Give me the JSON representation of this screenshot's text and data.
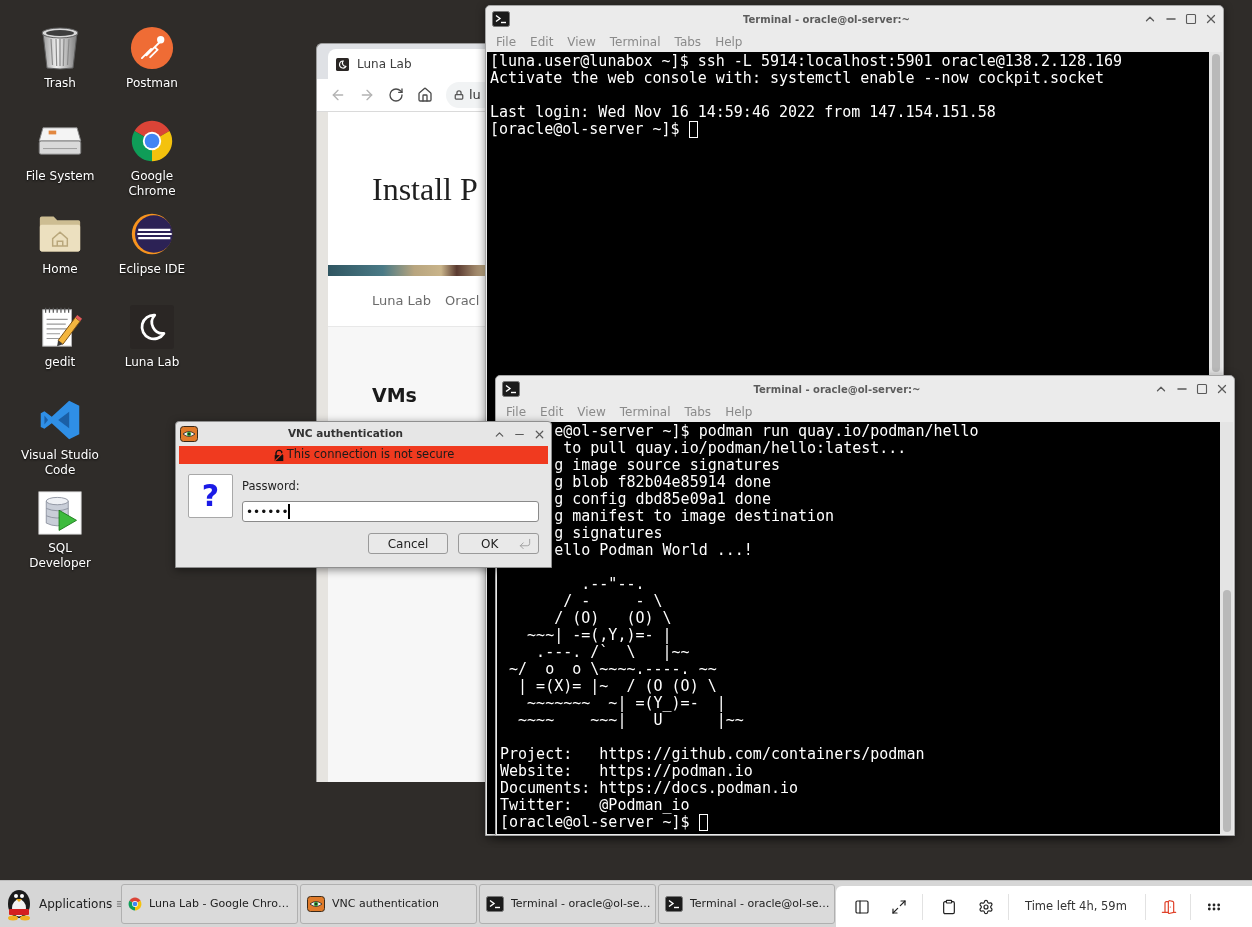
{
  "desktop_icons": [
    {
      "label": "Trash",
      "kind": "trash"
    },
    {
      "label": "File System",
      "kind": "drive"
    },
    {
      "label": "Home",
      "kind": "home"
    },
    {
      "label": "gedit",
      "kind": "gedit"
    },
    {
      "label": "Visual Studio Code",
      "kind": "vscode"
    },
    {
      "label": "SQL Developer",
      "kind": "sqldev"
    },
    {
      "label": "Postman",
      "kind": "postman"
    },
    {
      "label": "Google Chrome",
      "kind": "chrome"
    },
    {
      "label": "Eclipse IDE",
      "kind": "eclipse"
    },
    {
      "label": "Luna Lab",
      "kind": "luna"
    }
  ],
  "browser": {
    "tab": "Luna Lab",
    "nav_buttons": [
      {
        "kind": "back",
        "disabled": true
      },
      {
        "kind": "forward",
        "disabled": true
      },
      {
        "kind": "reload",
        "disabled": false
      },
      {
        "kind": "home",
        "disabled": false
      }
    ],
    "url": "lu",
    "page": {
      "title": "Install P",
      "nav": [
        "Luna Lab",
        "Oracl"
      ],
      "section": "VMs"
    }
  },
  "terminals": [
    {
      "title": "Terminal - oracle@ol-server:~",
      "menu": [
        "File",
        "Edit",
        "View",
        "Terminal",
        "Tabs",
        "Help"
      ],
      "lines": [
        {
          "kind": "output",
          "text": "[luna.user@lunabox ~]$ ssh -L 5914:localhost:5901 oracle@138.2.128.169"
        },
        {
          "kind": "output",
          "text": "Activate the web console with: systemctl enable --now cockpit.socket"
        },
        {
          "kind": "blank"
        },
        {
          "kind": "output",
          "text": "Last login: Wed Nov 16 14:59:46 2022 from 147.154.151.58"
        },
        {
          "kind": "prompt",
          "text": "[oracle@ol-server ~]$"
        }
      ]
    },
    {
      "title": "Terminal - oracle@ol-server:~",
      "menu": [
        "File",
        "Edit",
        "View",
        "Terminal",
        "Tabs",
        "Help"
      ],
      "lines": [
        {
          "kind": "cut",
          "text": "e@ol-server ~]$ podman run quay.io/podman/hello"
        },
        {
          "kind": "cut",
          "text": " to pull quay.io/podman/hello:latest..."
        },
        {
          "kind": "cut",
          "text": "g image source signatures"
        },
        {
          "kind": "cut",
          "text": "g blob f82b04e85914 done"
        },
        {
          "kind": "cut",
          "text": "g config dbd85e09a1 done"
        },
        {
          "kind": "cut",
          "text": "g manifest to image destination"
        },
        {
          "kind": "cut",
          "text": "g signatures"
        },
        {
          "kind": "cut",
          "text": "ello Podman World ...!"
        },
        {
          "kind": "blank"
        },
        {
          "kind": "art",
          "text": "         .--\"--.\n       / -     - \\\n      / (O)   (O) \\\n   ~~~| -=(,Y,)=- |\n    .---. /`  \\   |~~\n ~/  o  o \\~~~~.----. ~~\n  | =(X)= |~  / (O (O) \\\n   ~~~~~~~  ~| =(Y_)=-  |\n  ~~~~    ~~~|   U      |~~"
        },
        {
          "kind": "blank"
        },
        {
          "kind": "output",
          "text": "Project:   https://github.com/containers/podman"
        },
        {
          "kind": "output",
          "text": "Website:   https://podman.io"
        },
        {
          "kind": "output",
          "text": "Documents: https://docs.podman.io"
        },
        {
          "kind": "output",
          "text": "Twitter:   @Podman_io"
        },
        {
          "kind": "prompt",
          "text": "[oracle@ol-server ~]$"
        }
      ]
    }
  ],
  "dialog": {
    "title": "VNC authentication",
    "warning": "This connection is not secure",
    "icon": "?",
    "field": {
      "label": "Password:",
      "value": "••••••"
    },
    "buttons": [
      {
        "label": "Cancel",
        "kind": "cancel"
      },
      {
        "label": "OK",
        "kind": "default"
      }
    ]
  },
  "taskbar": {
    "menu_button": "Applications",
    "tasks": [
      {
        "label": "Luna Lab - Google Chro…",
        "kind": "browser"
      },
      {
        "label": "VNC authentication",
        "kind": "vnc"
      },
      {
        "label": "Terminal - oracle@ol-se…",
        "kind": "terminal"
      },
      {
        "label": "Terminal - oracle@ol-se…",
        "kind": "terminal"
      }
    ]
  },
  "session_panel": {
    "time_left": "Time left 4h, 59m"
  }
}
